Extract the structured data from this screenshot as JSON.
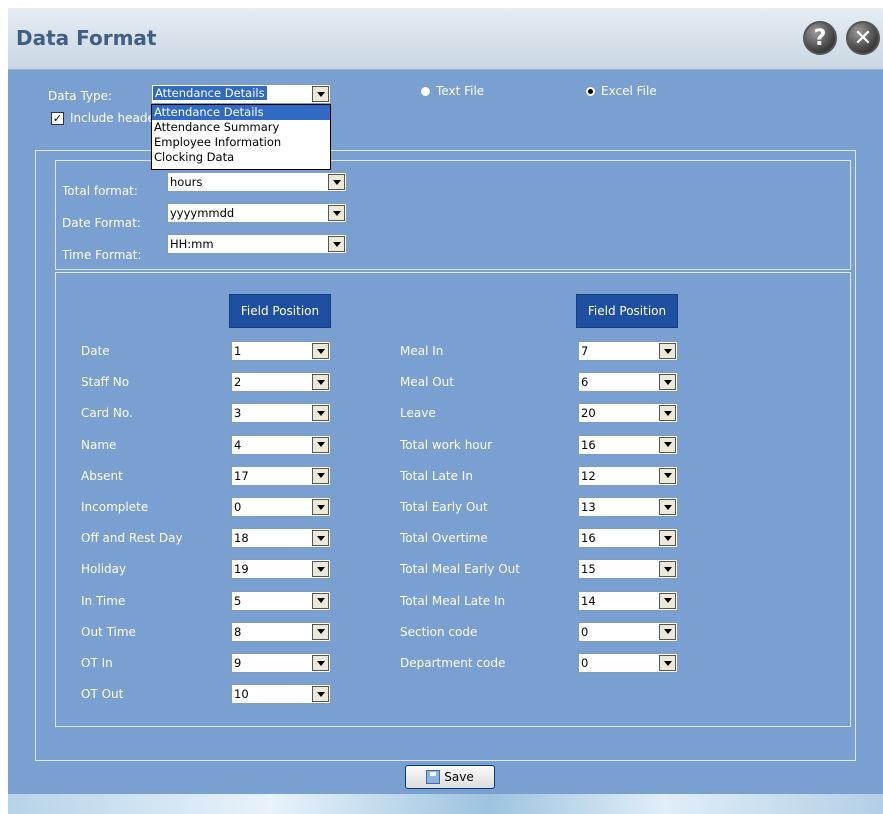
{
  "window": {
    "title": "Data Format"
  },
  "controls": {
    "data_type_label": "Data Type:",
    "data_type_value": "Attendance Details",
    "data_type_options": [
      "Attendance Details",
      "Attendance Summary",
      "Employee Information",
      "Clocking Data"
    ],
    "include_header_label": "Include heade",
    "include_header_checked": true,
    "text_file_label": "Text File",
    "excel_file_label": "Excel File",
    "selected_file_type": "Excel File"
  },
  "formats": {
    "total_label": "Total format:",
    "total_value": "hours",
    "date_label": "Date Format:",
    "date_value": "yyyymmdd",
    "time_label": "Time Format:",
    "time_value": "HH:mm"
  },
  "fields": {
    "header": "Field Position",
    "left": [
      {
        "label": "Date",
        "value": "1"
      },
      {
        "label": "Staff No",
        "value": "2"
      },
      {
        "label": "Card No.",
        "value": "3"
      },
      {
        "label": "Name",
        "value": "4"
      },
      {
        "label": "Absent",
        "value": "17"
      },
      {
        "label": "Incomplete",
        "value": "0"
      },
      {
        "label": "Off and Rest Day",
        "value": "18"
      },
      {
        "label": "Holiday",
        "value": "19"
      },
      {
        "label": "In Time",
        "value": "5"
      },
      {
        "label": "Out Time",
        "value": "8"
      },
      {
        "label": "OT In",
        "value": "9"
      },
      {
        "label": "OT Out",
        "value": "10"
      }
    ],
    "right": [
      {
        "label": "Meal In",
        "value": "7"
      },
      {
        "label": "Meal Out",
        "value": "6"
      },
      {
        "label": "Leave",
        "value": "20"
      },
      {
        "label": "Total work hour",
        "value": "16"
      },
      {
        "label": "Total Late In",
        "value": "12"
      },
      {
        "label": "Total Early Out",
        "value": "13"
      },
      {
        "label": "Total Overtime",
        "value": "16"
      },
      {
        "label": "Total Meal Early Out",
        "value": "15"
      },
      {
        "label": "Total Meal Late In",
        "value": "14"
      },
      {
        "label": "Section code",
        "value": "0"
      },
      {
        "label": "Department code",
        "value": "0"
      }
    ]
  },
  "footer": {
    "save_label": "Save"
  },
  "icons": {
    "help": "help-icon",
    "close": "close-icon",
    "save": "save-icon"
  },
  "colors": {
    "background": "#7a9fd1",
    "title": "#3f5f85",
    "header_fill": "#1f4fa0"
  }
}
